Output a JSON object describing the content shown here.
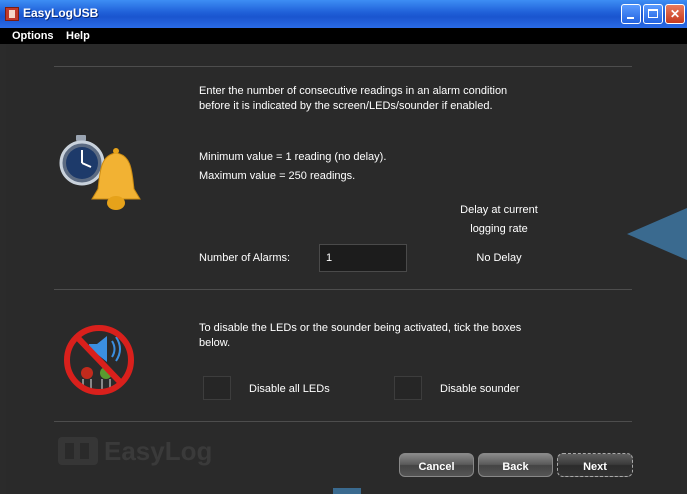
{
  "window": {
    "title": "EasyLogUSB"
  },
  "menu": {
    "items": [
      "Options",
      "Help"
    ]
  },
  "alarms": {
    "instructions": [
      "Enter the number of consecutive readings in an alarm condition",
      "before it is indicated by the screen/LEDs/sounder if enabled."
    ],
    "min_text": "Minimum value = 1 reading (no delay).",
    "max_text": "Maximum value = 250 readings.",
    "delay_header": [
      "Delay at current",
      "logging rate"
    ],
    "count_label": "Number of Alarms:",
    "count_value": "1",
    "delay_value": "No Delay"
  },
  "disable": {
    "instructions": [
      "To disable the LEDs or the sounder being activated, tick the boxes",
      "below."
    ],
    "leds_label": "Disable all LEDs",
    "leds_checked": false,
    "sounder_label": "Disable sounder",
    "sounder_checked": false
  },
  "logo": {
    "text": "EasyLog"
  },
  "buttons": {
    "cancel": "Cancel",
    "back": "Back",
    "next": "Next"
  },
  "colors": {
    "titlebar": "#2a6be6",
    "background": "#2a2a2a",
    "accent": "#3a6a8f",
    "bell": "#f2b233",
    "no_sign": "#d9201c"
  }
}
